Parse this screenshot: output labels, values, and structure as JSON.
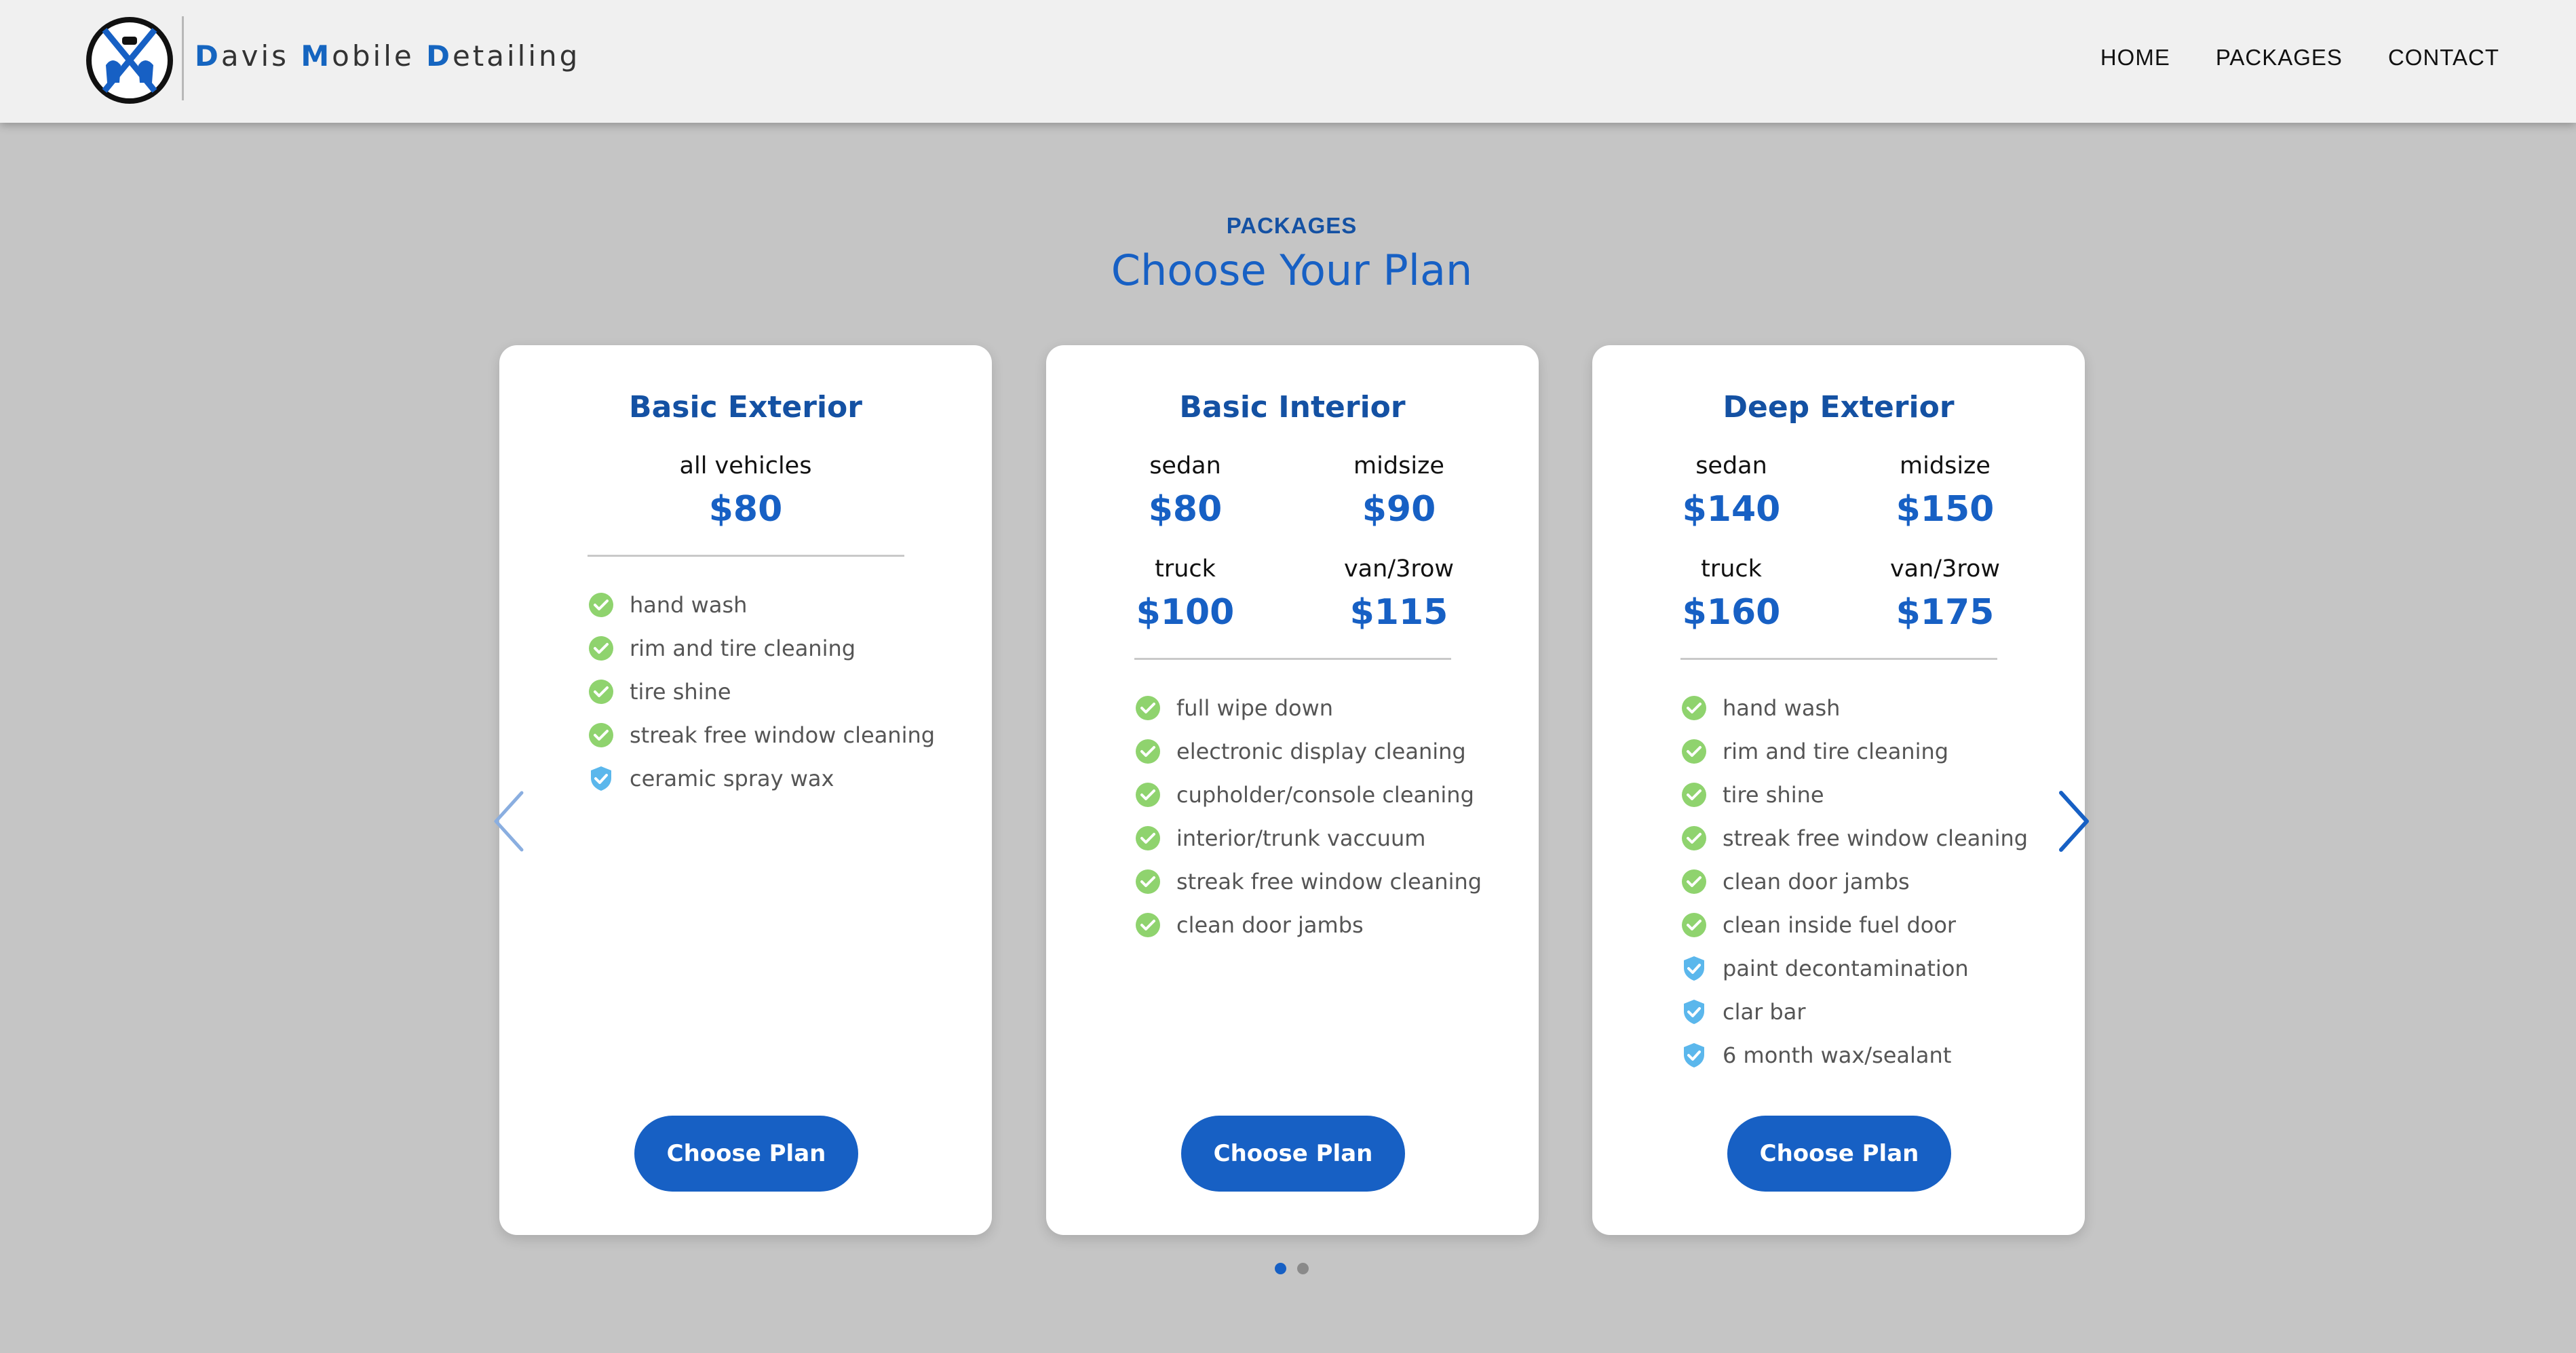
{
  "brand": {
    "letters": [
      "D",
      "avis ",
      "M",
      "obile ",
      "D",
      "etailing"
    ]
  },
  "nav": {
    "items": [
      "HOME",
      "PACKAGES",
      "CONTACT"
    ]
  },
  "section": {
    "eyebrow": "PACKAGES",
    "title": "Choose Your Plan"
  },
  "cards": [
    {
      "title": "Basic Exterior",
      "prices": [
        {
          "label": "all vehicles",
          "value": "$80"
        }
      ],
      "features": [
        {
          "text": "hand wash",
          "icon": "check-icon"
        },
        {
          "text": "rim and tire cleaning",
          "icon": "check-icon"
        },
        {
          "text": "tire shine",
          "icon": "check-icon"
        },
        {
          "text": "streak free window cleaning",
          "icon": "check-icon"
        },
        {
          "text": "ceramic spray wax",
          "icon": "shield-icon"
        }
      ],
      "button": "Choose Plan"
    },
    {
      "title": "Basic Interior",
      "prices": [
        {
          "label": "sedan",
          "value": "$80"
        },
        {
          "label": "midsize",
          "value": "$90"
        },
        {
          "label": "truck",
          "value": "$100"
        },
        {
          "label": "van/3row",
          "value": "$115"
        }
      ],
      "features": [
        {
          "text": "full wipe down",
          "icon": "check-icon"
        },
        {
          "text": "electronic display cleaning",
          "icon": "check-icon"
        },
        {
          "text": "cupholder/console cleaning",
          "icon": "check-icon"
        },
        {
          "text": "interior/trunk vaccuum",
          "icon": "check-icon"
        },
        {
          "text": "streak free window cleaning",
          "icon": "check-icon"
        },
        {
          "text": "clean door jambs",
          "icon": "check-icon"
        }
      ],
      "button": "Choose Plan"
    },
    {
      "title": "Deep Exterior",
      "prices": [
        {
          "label": "sedan",
          "value": "$140"
        },
        {
          "label": "midsize",
          "value": "$150"
        },
        {
          "label": "truck",
          "value": "$160"
        },
        {
          "label": "van/3row",
          "value": "$175"
        }
      ],
      "features": [
        {
          "text": "hand wash",
          "icon": "check-icon"
        },
        {
          "text": "rim and tire cleaning",
          "icon": "check-icon"
        },
        {
          "text": "tire shine",
          "icon": "check-icon"
        },
        {
          "text": "streak free window cleaning",
          "icon": "check-icon"
        },
        {
          "text": "clean door jambs",
          "icon": "check-icon"
        },
        {
          "text": "clean inside fuel door",
          "icon": "check-icon"
        },
        {
          "text": "paint decontamination",
          "icon": "shield-icon"
        },
        {
          "text": "clar bar",
          "icon": "shield-icon"
        },
        {
          "text": "6 month wax/sealant",
          "icon": "shield-icon"
        }
      ],
      "button": "Choose Plan"
    }
  ],
  "colors": {
    "brand_blue": "#1760c4",
    "dark_blue": "#1451a3",
    "check_green": "#8fd36e",
    "shield_blue": "#5bb7ec",
    "background": "#c5c5c5"
  },
  "carousel": {
    "active_dot": 0,
    "dot_count": 2
  }
}
